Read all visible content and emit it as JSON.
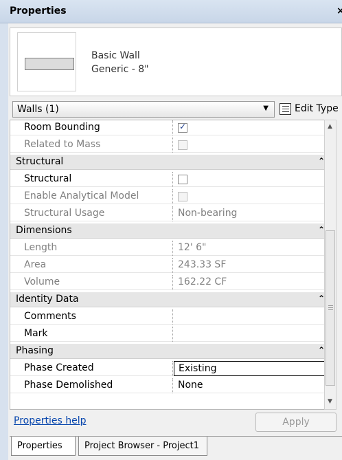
{
  "panel": {
    "title": "Properties",
    "close_label": "×"
  },
  "type_selector": {
    "family": "Basic Wall",
    "type": "Generic - 8\"",
    "dropdown_icon": "triangle-down"
  },
  "filter": {
    "selected": "Walls (1)",
    "edit_type_label": "Edit Type"
  },
  "rows": [
    {
      "kind": "param",
      "name": "Room Bounding",
      "control": "checkbox",
      "checked": true
    },
    {
      "kind": "param",
      "name": "Related to Mass",
      "control": "checkbox",
      "checked": false,
      "disabled": true
    },
    {
      "kind": "group",
      "name": "Structural"
    },
    {
      "kind": "param",
      "name": "Structural",
      "control": "checkbox",
      "checked": false
    },
    {
      "kind": "param",
      "name": "Enable Analytical Model",
      "control": "checkbox",
      "checked": false,
      "disabled": true
    },
    {
      "kind": "param",
      "name": "Structural Usage",
      "value": "Non-bearing",
      "disabled": true
    },
    {
      "kind": "group",
      "name": "Dimensions"
    },
    {
      "kind": "param",
      "name": "Length",
      "value": "12'  6\"",
      "disabled": true
    },
    {
      "kind": "param",
      "name": "Area",
      "value": "243.33 SF",
      "disabled": true
    },
    {
      "kind": "param",
      "name": "Volume",
      "value": "162.22 CF",
      "disabled": true
    },
    {
      "kind": "group",
      "name": "Identity Data"
    },
    {
      "kind": "param",
      "name": "Comments",
      "value": ""
    },
    {
      "kind": "param",
      "name": "Mark",
      "value": ""
    },
    {
      "kind": "group",
      "name": "Phasing"
    },
    {
      "kind": "param",
      "name": "Phase Created",
      "value": "Existing",
      "editing": true
    },
    {
      "kind": "param",
      "name": "Phase Demolished",
      "value": "None"
    }
  ],
  "footer": {
    "help_link": "Properties help",
    "apply_label": "Apply"
  },
  "tabs": [
    {
      "label": "Properties",
      "active": true
    },
    {
      "label": "Project Browser - Project1",
      "active": false
    }
  ],
  "colors": {
    "title_bar": "#c8d6e8",
    "group_bg": "#e6e6e6",
    "link": "#0645ad",
    "disabled_text": "#808080"
  }
}
